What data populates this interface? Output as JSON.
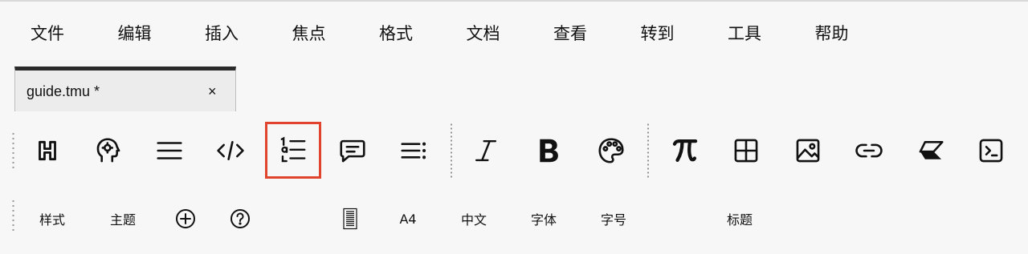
{
  "menubar": {
    "items": [
      "文件",
      "编辑",
      "插入",
      "焦点",
      "格式",
      "文档",
      "查看",
      "转到",
      "工具",
      "帮助"
    ]
  },
  "tab": {
    "title": "guide.tmu *",
    "close": "×"
  },
  "toolbar": {
    "icons": [
      "heading-icon",
      "brain-icon",
      "paragraph-icon",
      "code-icon",
      "ordered-list-icon",
      "comment-icon",
      "outline-icon",
      "italic-icon",
      "bold-icon",
      "palette-icon",
      "formula-icon",
      "table-icon",
      "image-icon",
      "link-icon",
      "eraser-icon",
      "terminal-icon"
    ],
    "selected_icon": "ordered-list-icon",
    "highlight_color": "#e0442d"
  },
  "secondary_toolbar": {
    "style": "样式",
    "theme": "主题",
    "page_size": "A4",
    "language": "中文",
    "font": "字体",
    "font_size": "字号",
    "heading": "标题"
  }
}
